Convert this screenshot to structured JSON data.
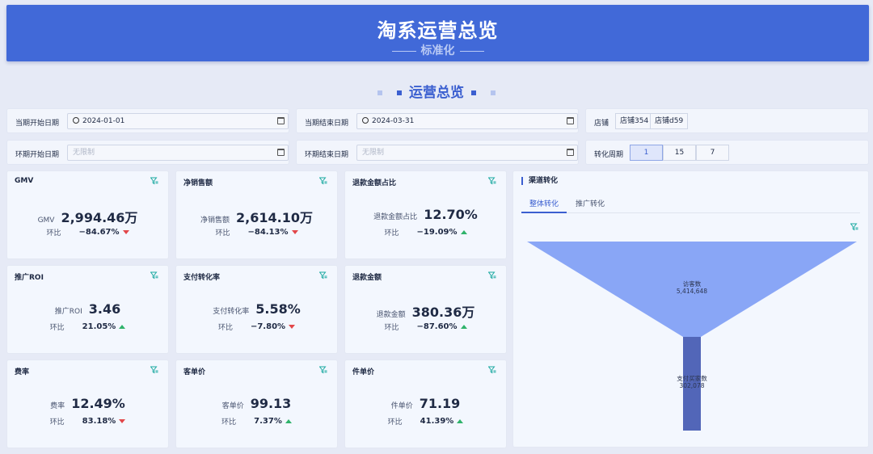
{
  "header": {
    "title": "淘系运营总览",
    "subtitle": "标准化"
  },
  "section": {
    "title": "运营总览"
  },
  "filters": {
    "current_start": {
      "label": "当期开始日期",
      "value": "2024-01-01"
    },
    "current_end": {
      "label": "当期结束日期",
      "value": "2024-03-31"
    },
    "store": {
      "label": "店铺",
      "options": [
        "店铺354",
        "店铺d59"
      ]
    },
    "prev_start": {
      "label": "环期开始日期",
      "placeholder": "无限制"
    },
    "prev_end": {
      "label": "环期结束日期",
      "placeholder": "无限制"
    },
    "cycle": {
      "label": "转化周期",
      "options": [
        "1",
        "15",
        "7"
      ],
      "selected": "1"
    }
  },
  "cards": [
    {
      "title": "GMV",
      "label": "GMV",
      "value": "2,994.46万",
      "ratio_label": "环比",
      "ratio": "−84.67%",
      "trend": "down"
    },
    {
      "title": "净销售额",
      "label": "净销售额",
      "value": "2,614.10万",
      "ratio_label": "环比",
      "ratio": "−84.13%",
      "trend": "down"
    },
    {
      "title": "退款金额占比",
      "label": "退款金额占比",
      "value": "12.70%",
      "ratio_label": "环比",
      "ratio": "−19.09%",
      "trend": "up"
    },
    {
      "title": "推广ROI",
      "label": "推广ROI",
      "value": "3.46",
      "ratio_label": "环比",
      "ratio": "21.05%",
      "trend": "up"
    },
    {
      "title": "支付转化率",
      "label": "支付转化率",
      "value": "5.58%",
      "ratio_label": "环比",
      "ratio": "−7.80%",
      "trend": "down"
    },
    {
      "title": "退款金额",
      "label": "退款金额",
      "value": "380.36万",
      "ratio_label": "环比",
      "ratio": "−87.60%",
      "trend": "up"
    },
    {
      "title": "费率",
      "label": "费率",
      "value": "12.49%",
      "ratio_label": "环比",
      "ratio": "83.18%",
      "trend": "down"
    },
    {
      "title": "客单价",
      "label": "客单价",
      "value": "99.13",
      "ratio_label": "环比",
      "ratio": "7.37%",
      "trend": "up"
    },
    {
      "title": "件单价",
      "label": "件单价",
      "value": "71.19",
      "ratio_label": "环比",
      "ratio": "41.39%",
      "trend": "up"
    }
  ],
  "channel": {
    "title": "渠道转化",
    "tabs": [
      "整体转化",
      "推广转化"
    ],
    "active_tab": "整体转化"
  },
  "chart_data": {
    "type": "funnel",
    "stages": [
      {
        "name": "访客数",
        "value": 5414648,
        "value_label": "5,414,648"
      },
      {
        "name": "支付买家数",
        "value": 302078,
        "value_label": "302,078"
      }
    ],
    "colors": [
      "#89a6f6",
      "#5266b8"
    ]
  },
  "colors": {
    "header": "#4169d8",
    "accent": "#3b5fd0",
    "up": "#2fb36b",
    "down": "#e2474a"
  }
}
